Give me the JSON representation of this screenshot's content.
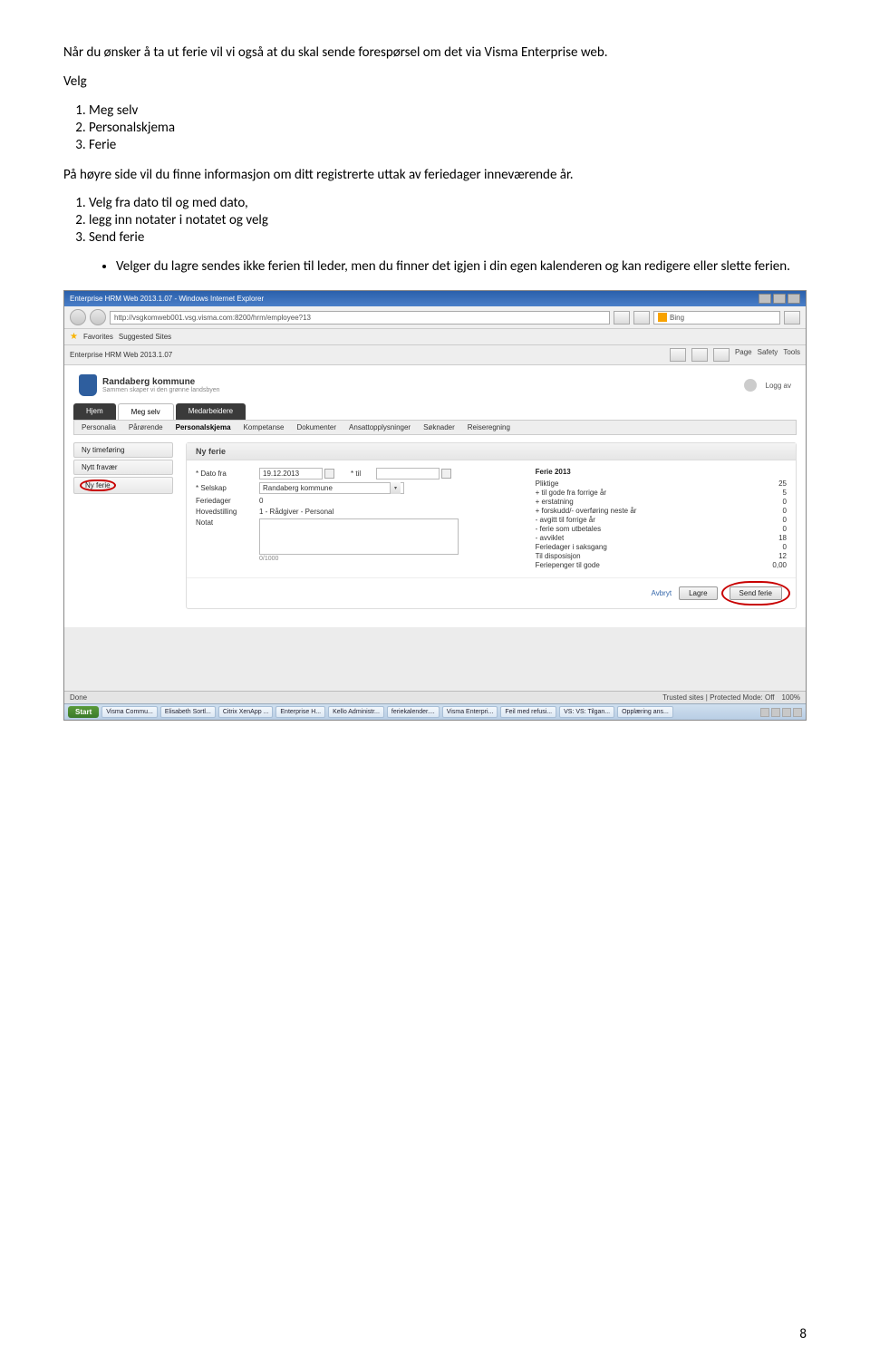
{
  "doc": {
    "intro": "Når du ønsker å ta ut ferie vil vi også at du skal sende forespørsel om det via Visma Enterprise web.",
    "velg": "Velg",
    "list1": {
      "i1": "Meg selv",
      "i2": "Personalskjema",
      "i3": "Ferie"
    },
    "middle": "På høyre side vil du finne informasjon om ditt registrerte uttak av feriedager inneværende år.",
    "list2": {
      "i1": "Velg fra dato til og med dato,",
      "i2": "legg inn notater i notatet og velg",
      "i3": "Send ferie"
    },
    "bullet": "Velger du lagre sendes ikke ferien til leder, men du finner det igjen i din egen kalenderen og kan redigere eller slette  ferien.",
    "page": "8"
  },
  "window": {
    "title": "Enterprise HRM Web 2013.1.07 - Windows Internet Explorer",
    "url": "http://vsgkomweb001.vsg.visma.com:8200/hrm/employee?13",
    "bing": "Bing",
    "favorites": "Favorites",
    "suggested": "Suggested Sites",
    "tab": "Enterprise HRM Web 2013.1.07",
    "tools": {
      "page": "Page",
      "safety": "Safety",
      "tools": "Tools"
    }
  },
  "brand": {
    "name": "Randaberg kommune",
    "slogan": "Sammen skaper vi den grønne landsbyen",
    "logav": "Logg av"
  },
  "tabs": {
    "hjem": "Hjem",
    "meg": "Meg selv",
    "med": "Medarbeidere"
  },
  "subnav": {
    "personalia": "Personalia",
    "parorende": "Pårørende",
    "pskjema": "Personalskjema",
    "komp": "Kompetanse",
    "dok": "Dokumenter",
    "ansatt": "Ansattopplysninger",
    "sokn": "Søknader",
    "reise": "Reiseregning"
  },
  "side": {
    "tf": "Ny timeføring",
    "fravaer": "Nytt fravær",
    "ferie": "Ny ferie"
  },
  "form": {
    "head": "Ny ferie",
    "labels": {
      "fra": "* Dato fra",
      "til": "* til",
      "selskap": "* Selskap",
      "fdager": "Feriedager",
      "hoved": "Hovedstilling",
      "notat": "Notat"
    },
    "val": {
      "fra": "19.12.2013",
      "selskap": "Randaberg kommune",
      "fdager": "0",
      "hoved": "1 - Rådgiver - Personal"
    },
    "counter": "0/1000"
  },
  "balance": {
    "head": "Ferie 2013",
    "rows": [
      {
        "l": "Pliktige",
        "v": "25"
      },
      {
        "l": "+ til gode fra forrige år",
        "v": "5"
      },
      {
        "l": "+ erstatning",
        "v": "0"
      },
      {
        "l": "+ forskudd/- overføring neste år",
        "v": "0"
      },
      {
        "l": "- avgitt til forrige år",
        "v": "0"
      },
      {
        "l": "- ferie som utbetales",
        "v": "0"
      },
      {
        "l": "- avviklet",
        "v": "18"
      },
      {
        "l": "Feriedager i saksgang",
        "v": "0"
      },
      {
        "l": "Til disposisjon",
        "v": "12"
      },
      {
        "l": "Feriepenger til gode",
        "v": "0,00"
      }
    ]
  },
  "actions": {
    "avbryt": "Avbryt",
    "lagre": "Lagre",
    "send": "Send ferie"
  },
  "status": {
    "done": "Done",
    "trusted": "Trusted sites | Protected Mode: Off",
    "zoom": "100%"
  },
  "taskbar": {
    "start": "Start",
    "items": [
      "Visma Commu...",
      "Elisabeth Sortl...",
      "Citrix XenApp ...",
      "Enterprise H...",
      "Kello Administr...",
      "feriekalender....",
      "Visma Enterpri...",
      "Feil med refusi...",
      "VS: VS: Tilgan...",
      "Opplæring ans..."
    ]
  }
}
